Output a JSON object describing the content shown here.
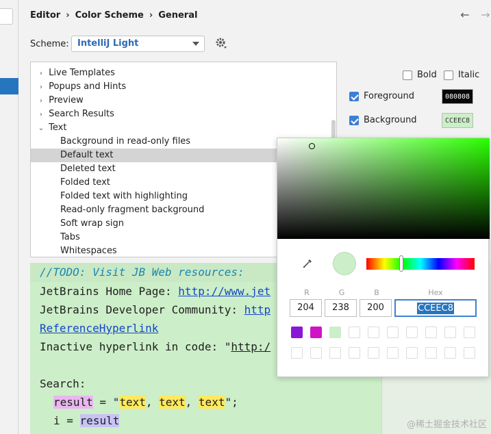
{
  "breadcrumb": [
    "Editor",
    "Color Scheme",
    "General"
  ],
  "scheme": {
    "label": "Scheme:",
    "value": "IntelliJ Light"
  },
  "tree": {
    "items": [
      {
        "label": "Live Templates",
        "expandable": true,
        "indent": 0
      },
      {
        "label": "Popups and Hints",
        "expandable": true,
        "indent": 0
      },
      {
        "label": "Preview",
        "expandable": true,
        "indent": 0
      },
      {
        "label": "Search Results",
        "expandable": true,
        "indent": 0
      },
      {
        "label": "Text",
        "expandable": true,
        "expanded": true,
        "indent": 0
      },
      {
        "label": "Background in read-only files",
        "indent": 1
      },
      {
        "label": "Default text",
        "indent": 1,
        "selected": true
      },
      {
        "label": "Deleted text",
        "indent": 1
      },
      {
        "label": "Folded text",
        "indent": 1
      },
      {
        "label": "Folded text with highlighting",
        "indent": 1
      },
      {
        "label": "Read-only fragment background",
        "indent": 1
      },
      {
        "label": "Soft wrap sign",
        "indent": 1
      },
      {
        "label": "Tabs",
        "indent": 1
      },
      {
        "label": "Whitespaces",
        "indent": 1
      }
    ]
  },
  "options": {
    "bold": "Bold",
    "italic": "Italic",
    "foreground": {
      "label": "Foreground",
      "checked": true,
      "value": "080808",
      "color": "#080808"
    },
    "background": {
      "label": "Background",
      "checked": true,
      "value": "CCEEC8",
      "color": "#cceec8"
    }
  },
  "editor": {
    "todo": "//TODO: Visit JB Web resources:",
    "home_label": "JetBrains Home Page: ",
    "home_link": "http://www.jet",
    "community_label": "JetBrains Developer Community: ",
    "community_link": "http",
    "ref_link": "ReferenceHyperlink",
    "inactive_label": "Inactive hyperlink in code: \"",
    "inactive_link": "http:/",
    "search_label": "Search:",
    "result_var": "result",
    "assign": " = \"",
    "text1": "text",
    "comma": ", ",
    "text2": "text",
    "text3": "text",
    "end_quote": "\";",
    "i_var": "i",
    "i_assign": " = ",
    "i_result": "result"
  },
  "picker": {
    "labels": {
      "r": "R",
      "g": "G",
      "b": "B",
      "hex": "Hex"
    },
    "values": {
      "r": "204",
      "g": "238",
      "b": "200",
      "hex": "CCEEC8"
    },
    "recent_colors": [
      "#8a16d6",
      "#cf14c8",
      "#cceec8"
    ],
    "hue_color": "#2bff00"
  },
  "watermark": "@稀土掘金技术社区"
}
